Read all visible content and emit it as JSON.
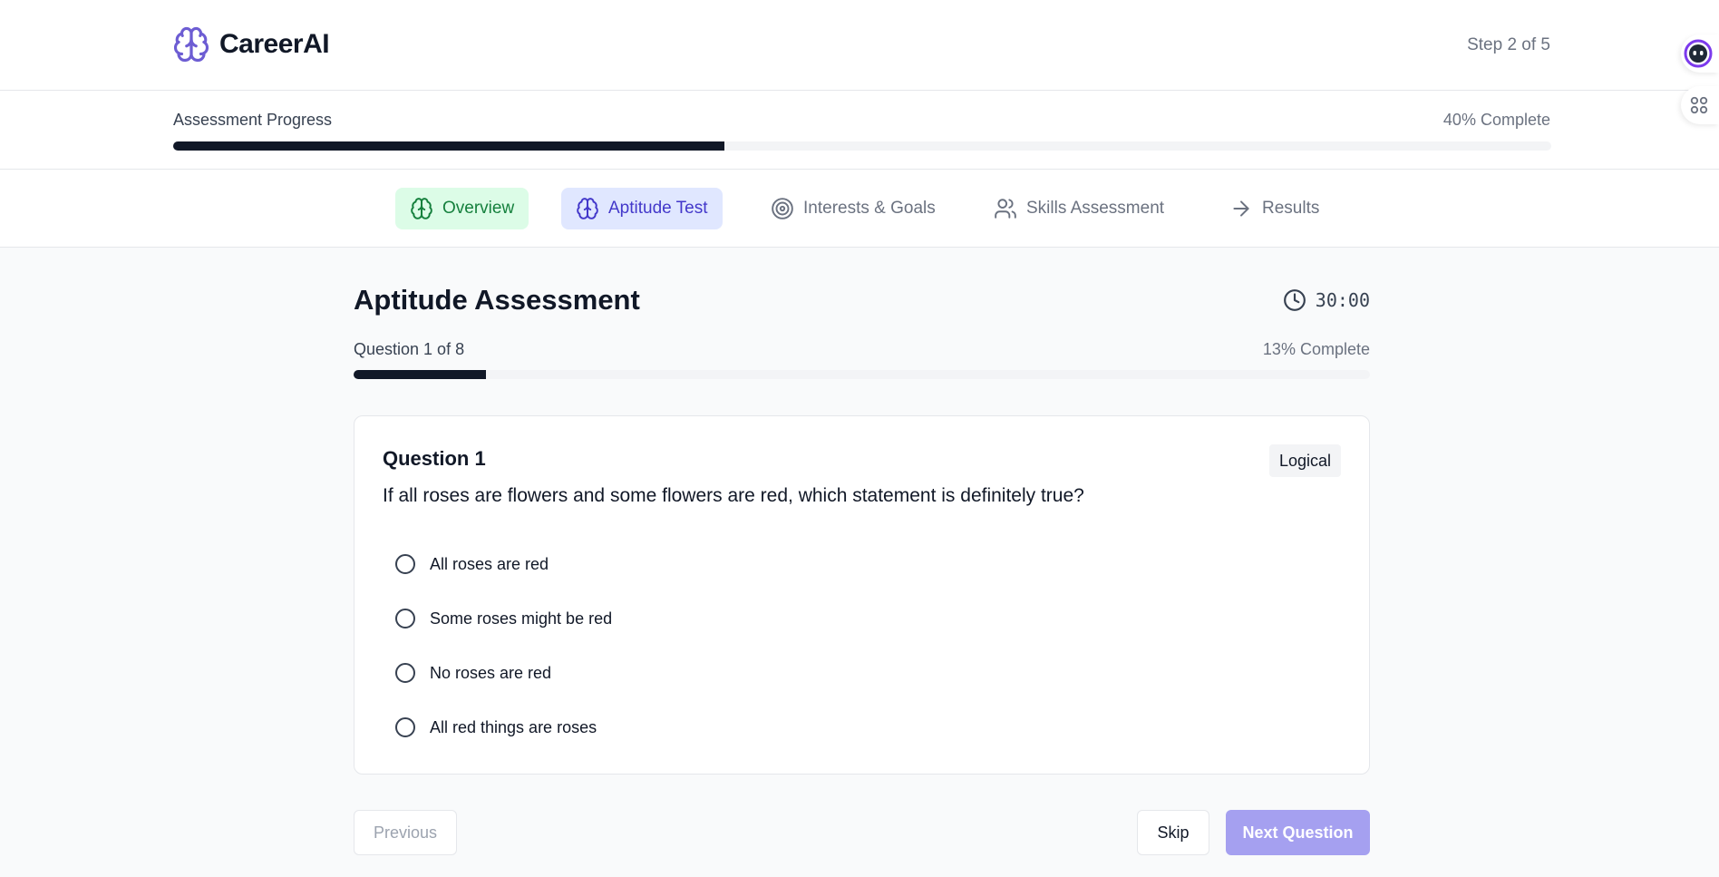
{
  "header": {
    "brand": "CareerAI",
    "step": "Step 2 of 5"
  },
  "assessment_progress": {
    "label": "Assessment Progress",
    "percent_text": "40% Complete",
    "fraction": 0.4
  },
  "tabs": [
    {
      "label": "Overview",
      "icon": "brain-icon",
      "state": "done"
    },
    {
      "label": "Aptitude Test",
      "icon": "brain-icon",
      "state": "active"
    },
    {
      "label": "Interests & Goals",
      "icon": "target-icon",
      "state": "inactive"
    },
    {
      "label": "Skills Assessment",
      "icon": "users-icon",
      "state": "inactive"
    },
    {
      "label": "Results",
      "icon": "arrow-right-icon",
      "state": "inactive"
    }
  ],
  "main": {
    "title": "Aptitude Assessment",
    "timer": "30:00",
    "question_count": "Question 1 of 8",
    "question_percent": "13% Complete",
    "question_fraction": 0.13
  },
  "question": {
    "title": "Question 1",
    "category": "Logical",
    "text": "If all roses are flowers and some flowers are red, which statement is definitely true?",
    "options": [
      "All roses are red",
      "Some roses might be red",
      "No roses are red",
      "All red things are roses"
    ],
    "selected": null
  },
  "buttons": {
    "previous": "Previous",
    "skip": "Skip",
    "next": "Next Question"
  },
  "colors": {
    "brand": "#6d5dd3",
    "progress_fill": "#111827",
    "tab_done_bg": "#dcfce7",
    "tab_done_text": "#15803d",
    "tab_active_bg": "#e0e7ff",
    "tab_active_text": "#4338ca",
    "next_button": "#a5a0f0"
  }
}
